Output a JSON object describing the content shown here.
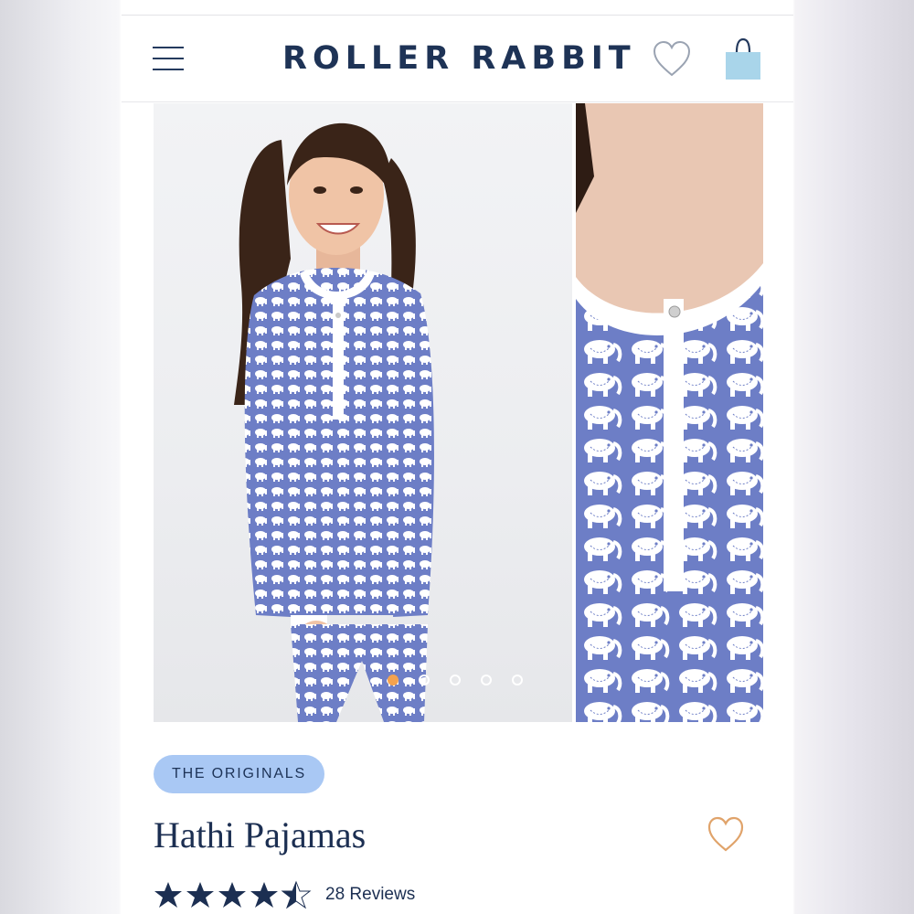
{
  "brand": {
    "logo_text": "ROLLER RABBIT",
    "color": "#1e3356"
  },
  "header": {
    "menu_icon": "hamburger-menu-icon",
    "wishlist_icon": "heart-outline-icon",
    "bag_icon": "shopping-bag-icon"
  },
  "gallery": {
    "slides": [
      {
        "icon": "model-photo",
        "description_visible": false
      },
      {
        "icon": "neckline-detail-photo",
        "description_visible": false
      }
    ],
    "dot_count": 5,
    "active_dot": 1,
    "active_dot_color": "#f4a24e"
  },
  "product": {
    "badge": "THE ORIGINALS",
    "badge_color": "#a9c8f4",
    "title": "Hathi Pajamas",
    "favorite_icon": "heart-outline-icon",
    "favorite_color": "#e0a36a",
    "rating": 4.5,
    "rating_max": 5,
    "reviews_label": "28 Reviews"
  },
  "colors": {
    "navy": "#1e3356",
    "print_blue": "#6d7ec6",
    "accent_orange": "#f4a24e"
  }
}
